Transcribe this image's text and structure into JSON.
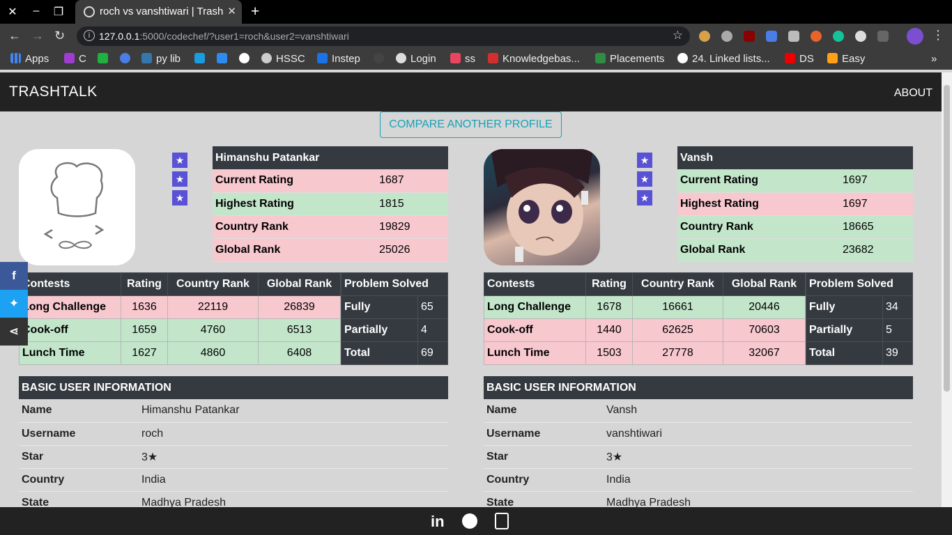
{
  "browser": {
    "tab_title": "roch vs vanshtiwari | Trash",
    "url_host": "127.0.0.1",
    "url_rest": ":5000/codechef/?user1=roch&user2=vanshtiwari",
    "bookmarks": [
      "Apps",
      "C",
      "py lib",
      "HSSC",
      "Instep",
      "Login",
      "ss",
      "Knowledgebas...",
      "Placements",
      "24. Linked lists...",
      "DS",
      "Easy"
    ]
  },
  "nav": {
    "brand": "TRASHTALK",
    "about": "ABOUT",
    "compare": "COMPARE ANOTHER PROFILE"
  },
  "user1": {
    "name": "Himanshu Patankar",
    "stars": [
      "★",
      "★",
      "★"
    ],
    "ratings": [
      {
        "label": "Current Rating",
        "value": "1687"
      },
      {
        "label": "Highest Rating",
        "value": "1815"
      },
      {
        "label": "Country Rank",
        "value": "19829"
      },
      {
        "label": "Global Rank",
        "value": "25026"
      }
    ],
    "contests_headers": [
      "Contests",
      "Rating",
      "Country Rank",
      "Global Rank"
    ],
    "contests": [
      {
        "name": "Long Challenge",
        "rating": "1636",
        "country": "22119",
        "global": "26839"
      },
      {
        "name": "Cook-off",
        "rating": "1659",
        "country": "4760",
        "global": "6513"
      },
      {
        "name": "Lunch Time",
        "rating": "1627",
        "country": "4860",
        "global": "6408"
      }
    ],
    "solved_header": "Problem Solved",
    "solved": [
      {
        "label": "Fully",
        "value": "65"
      },
      {
        "label": "Partially",
        "value": "4"
      },
      {
        "label": "Total",
        "value": "69"
      }
    ],
    "info_header": "BASIC USER INFORMATION",
    "info": [
      {
        "label": "Name",
        "value": "Himanshu Patankar"
      },
      {
        "label": "Username",
        "value": "roch"
      },
      {
        "label": "Star",
        "value": "3★"
      },
      {
        "label": "Country",
        "value": "India"
      },
      {
        "label": "State",
        "value": "Madhya Pradesh"
      }
    ]
  },
  "user2": {
    "name": "Vansh",
    "stars": [
      "★",
      "★",
      "★"
    ],
    "ratings": [
      {
        "label": "Current Rating",
        "value": "1697"
      },
      {
        "label": "Highest Rating",
        "value": "1697"
      },
      {
        "label": "Country Rank",
        "value": "18665"
      },
      {
        "label": "Global Rank",
        "value": "23682"
      }
    ],
    "contests_headers": [
      "Contests",
      "Rating",
      "Country Rank",
      "Global Rank"
    ],
    "contests": [
      {
        "name": "Long Challenge",
        "rating": "1678",
        "country": "16661",
        "global": "20446"
      },
      {
        "name": "Cook-off",
        "rating": "1440",
        "country": "62625",
        "global": "70603"
      },
      {
        "name": "Lunch Time",
        "rating": "1503",
        "country": "27778",
        "global": "32067"
      }
    ],
    "solved_header": "Problem Solved",
    "solved": [
      {
        "label": "Fully",
        "value": "34"
      },
      {
        "label": "Partially",
        "value": "5"
      },
      {
        "label": "Total",
        "value": "39"
      }
    ],
    "info_header": "BASIC USER INFORMATION",
    "info": [
      {
        "label": "Name",
        "value": "Vansh"
      },
      {
        "label": "Username",
        "value": "vanshtiwari"
      },
      {
        "label": "Star",
        "value": "3★"
      },
      {
        "label": "Country",
        "value": "India"
      },
      {
        "label": "State",
        "value": "Madhya Pradesh"
      }
    ]
  },
  "colors": {
    "better": "#c3e6cb",
    "worse": "#f8c8cf",
    "dark": "#343a40",
    "accent": "#17a2b8",
    "star": "#5a52d5"
  }
}
